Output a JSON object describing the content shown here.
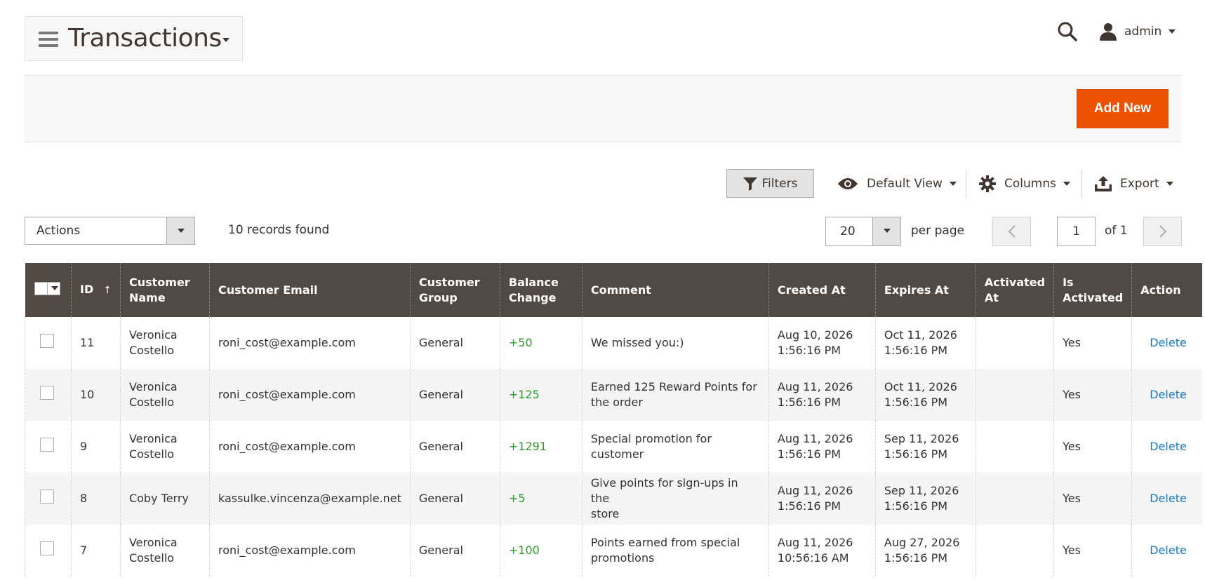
{
  "header": {
    "title": "Transactions",
    "username": "admin"
  },
  "action_bar": {
    "add_new_label": "Add New"
  },
  "toolbar": {
    "filters_label": "Filters",
    "view_label": "Default View",
    "columns_label": "Columns",
    "export_label": "Export",
    "actions_label": "Actions",
    "records_found": "10 records found",
    "per_page_value": "20",
    "per_page_label": "per page",
    "current_page": "1",
    "page_of": "of 1"
  },
  "table": {
    "sort_indicator": "↑",
    "columns": {
      "id": "ID",
      "customer_name": [
        "Customer",
        "Name"
      ],
      "customer_email": "Customer Email",
      "customer_group": [
        "Customer",
        "Group"
      ],
      "balance_change": [
        "Balance",
        "Change"
      ],
      "comment": "Comment",
      "created_at": "Created At",
      "expires_at": "Expires At",
      "activated_at": [
        "Activated",
        "At"
      ],
      "is_activated": [
        "Is",
        "Activated"
      ],
      "action": "Action"
    },
    "rows": [
      {
        "id": "11",
        "name": [
          "Veronica",
          "Costello"
        ],
        "email": "roni_cost@example.com",
        "group": "General",
        "balance": "+50",
        "comment": [
          "We missed you:)",
          ""
        ],
        "created": [
          "Aug 10, 2026",
          "1:56:16 PM"
        ],
        "expires": [
          "Oct 11, 2026",
          "1:56:16 PM"
        ],
        "activated_at": "",
        "is_activated": "Yes",
        "action": "Delete"
      },
      {
        "id": "10",
        "name": [
          "Veronica",
          "Costello"
        ],
        "email": "roni_cost@example.com",
        "group": "General",
        "balance": "+125",
        "comment": [
          "Earned 125 Reward Points for",
          "the order"
        ],
        "created": [
          "Aug 11, 2026",
          "1:56:16 PM"
        ],
        "expires": [
          "Oct 11, 2026",
          "1:56:16 PM"
        ],
        "activated_at": "",
        "is_activated": "Yes",
        "action": "Delete"
      },
      {
        "id": "9",
        "name": [
          "Veronica",
          "Costello"
        ],
        "email": "roni_cost@example.com",
        "group": "General",
        "balance": "+1291",
        "comment": [
          "Special promotion for",
          "customer"
        ],
        "created": [
          "Aug 11, 2026",
          "1:56:16 PM"
        ],
        "expires": [
          "Sep 11, 2026",
          "1:56:16 PM"
        ],
        "activated_at": "",
        "is_activated": "Yes",
        "action": "Delete"
      },
      {
        "id": "8",
        "name": [
          "Coby Terry",
          ""
        ],
        "email": "kassulke.vincenza@example.net",
        "group": "General",
        "balance": "+5",
        "comment": [
          "Give points for sign-ups in the",
          "store"
        ],
        "created": [
          "Aug 11, 2026",
          "1:56:16 PM"
        ],
        "expires": [
          "Sep 11, 2026",
          "1:56:16 PM"
        ],
        "activated_at": "",
        "is_activated": "Yes",
        "action": "Delete"
      },
      {
        "id": "7",
        "name": [
          "Veronica",
          "Costello"
        ],
        "email": "roni_cost@example.com",
        "group": "General",
        "balance": "+100",
        "comment": [
          "Points earned from special",
          "promotions"
        ],
        "created": [
          "Aug 11, 2026",
          "10:56:16 AM"
        ],
        "expires": [
          "Aug 27, 2026",
          "1:56:16 PM"
        ],
        "activated_at": "",
        "is_activated": "Yes",
        "action": "Delete"
      }
    ]
  },
  "colors": {
    "accent": "#eb5202",
    "table_header": "#514943",
    "link": "#1979c3",
    "positive": "#2a9c2a"
  }
}
